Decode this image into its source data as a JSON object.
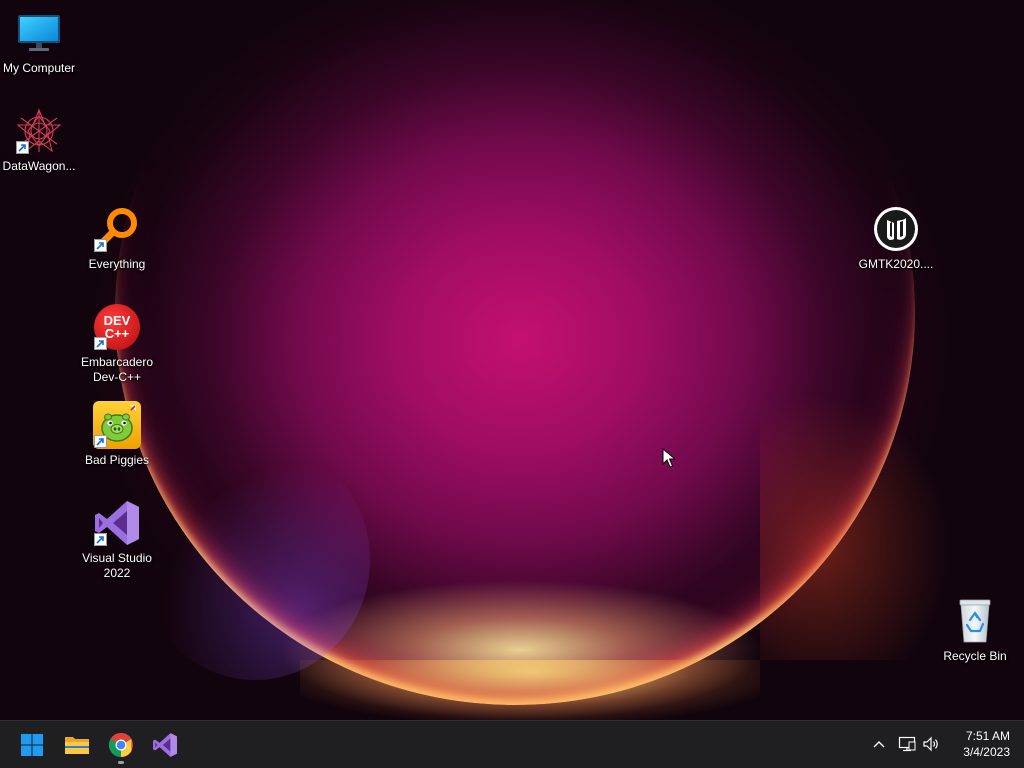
{
  "desktop": {
    "icons": [
      {
        "label": "My Computer",
        "icon": "monitor-icon",
        "shortcut": false
      },
      {
        "label": "DataWagon...",
        "icon": "datawagon-icon",
        "shortcut": true
      },
      {
        "label": "Everything",
        "icon": "everything-search-icon",
        "shortcut": true
      },
      {
        "label": "Embarcadero\nDev-C++",
        "icon": "devcpp-icon",
        "icon_text": "DEV\nC++",
        "shortcut": true
      },
      {
        "label": "Bad Piggies",
        "icon": "bad-piggies-icon",
        "shortcut": true
      },
      {
        "label": "Visual Studio\n2022",
        "icon": "visual-studio-icon",
        "shortcut": true
      },
      {
        "label": "GMTK2020....",
        "icon": "unreal-engine-icon",
        "shortcut": false
      },
      {
        "label": "Recycle Bin",
        "icon": "recycle-bin-icon",
        "shortcut": false
      }
    ]
  },
  "taskbar": {
    "apps": [
      {
        "name": "start",
        "icon": "windows-start-icon",
        "running": false
      },
      {
        "name": "file-explorer",
        "icon": "folder-icon",
        "running": false
      },
      {
        "name": "chrome",
        "icon": "chrome-icon",
        "running": true
      },
      {
        "name": "visual-studio",
        "icon": "visual-studio-icon",
        "running": false
      }
    ],
    "tray": {
      "icons": [
        "chevron-up-icon",
        "network-icon",
        "volume-icon"
      ]
    },
    "clock": {
      "time": "7:51 AM",
      "date": "3/4/2023"
    }
  },
  "colors": {
    "taskbar_bg": "#1f1f22",
    "wallpaper_center": "#c4106f",
    "wallpaper_edge": "#12040d",
    "start_blue": "#1e9bf0"
  }
}
